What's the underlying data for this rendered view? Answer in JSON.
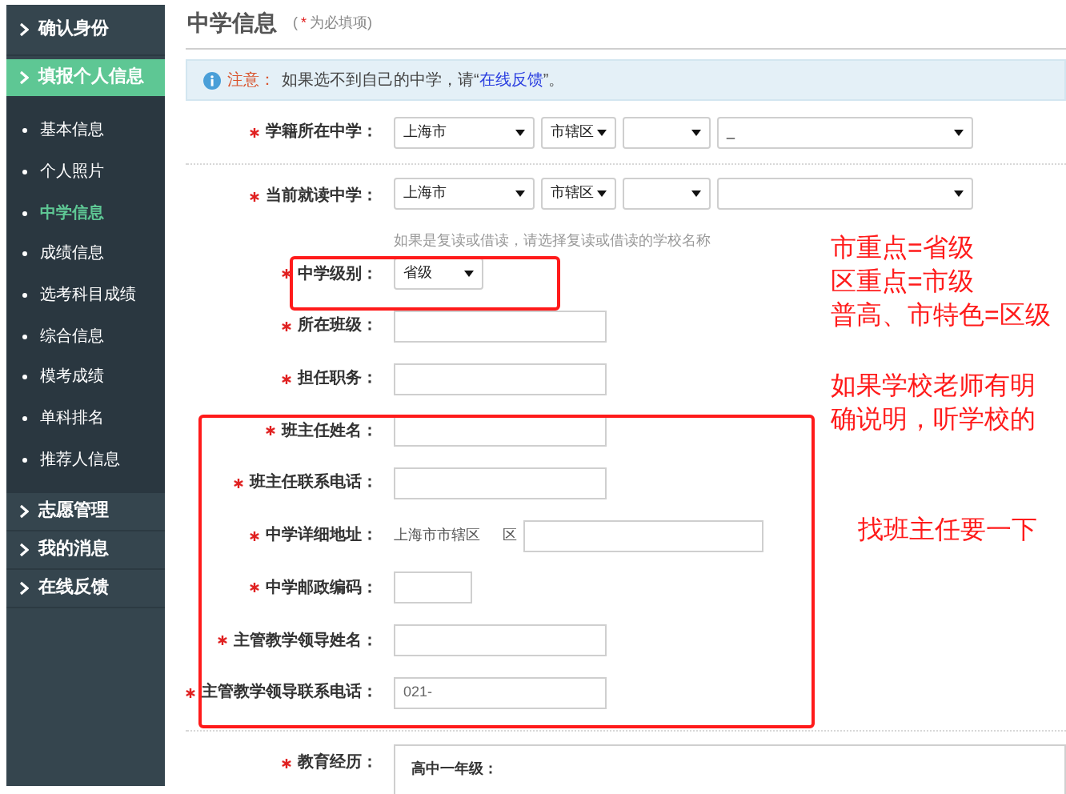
{
  "sidebar": {
    "items": [
      {
        "label": "确认身份",
        "selected": false
      },
      {
        "label": "填报个人信息",
        "selected": true,
        "children": [
          {
            "label": "基本信息",
            "selected": false
          },
          {
            "label": "个人照片",
            "selected": false
          },
          {
            "label": "中学信息",
            "selected": true
          },
          {
            "label": "成绩信息",
            "selected": false
          },
          {
            "label": "选考科目成绩",
            "selected": false
          },
          {
            "label": "综合信息",
            "selected": false
          },
          {
            "label": "模考成绩",
            "selected": false
          },
          {
            "label": "单科排名",
            "selected": false
          },
          {
            "label": "推荐人信息",
            "selected": false
          }
        ]
      },
      {
        "label": "志愿管理",
        "selected": false
      },
      {
        "label": "我的消息",
        "selected": false
      },
      {
        "label": "在线反馈",
        "selected": false
      }
    ]
  },
  "header": {
    "title": "中学信息",
    "note_open": "(",
    "note_star": "*",
    "note_text": "为必填项)"
  },
  "notice": {
    "label": "注意：",
    "text_before": "如果选不到自己的中学，请“",
    "link": "在线反馈",
    "text_after": "”。"
  },
  "form": {
    "rows": [
      {
        "kind": "selects",
        "label": "学籍所在中学：",
        "required": true,
        "selects": [
          {
            "kind": "dropdown",
            "value": "上海市"
          },
          {
            "kind": "dropdown",
            "value": "市辖区"
          },
          {
            "kind": "dropdown"
          },
          {
            "kind": "dropdown",
            "value": "_"
          }
        ]
      },
      {
        "kind": "selects",
        "label": "当前就读中学：",
        "required": true,
        "selects": [
          {
            "kind": "dropdown",
            "value": "上海市"
          },
          {
            "kind": "dropdown",
            "value": "市辖区"
          },
          {
            "kind": "dropdown"
          },
          {
            "kind": "dropdown"
          }
        ],
        "hint": "如果是复读或借读，请选择复读或借读的学校名称"
      },
      {
        "kind": "select",
        "label": "中学级别：",
        "required": true,
        "value": "省级"
      },
      {
        "kind": "input",
        "label": "所在班级：",
        "required": true
      },
      {
        "kind": "input",
        "label": "担任职务：",
        "required": true
      },
      {
        "kind": "input",
        "label": "班主任姓名：",
        "required": true
      },
      {
        "kind": "input",
        "label": "班主任联系电话：",
        "required": true
      },
      {
        "kind": "address",
        "label": "中学详细地址：",
        "required": true,
        "prefix": "上海市市辖区",
        "suffix": "区"
      },
      {
        "kind": "short-input",
        "label": "中学邮政编码：",
        "required": true
      },
      {
        "kind": "input",
        "label": "主管教学领导姓名：",
        "required": true
      },
      {
        "kind": "input",
        "label": "主管教学领导联系电话：",
        "required": true,
        "value": "021-"
      },
      {
        "kind": "textarea",
        "label": "教育经历：",
        "required": true,
        "value": "高中一年级："
      }
    ]
  },
  "annotations": {
    "notes": [
      {
        "lines": [
          "市重点=省级",
          "区重点=市级",
          "普高、市特色=区级"
        ]
      },
      {
        "lines": [
          "如果学校老师有明",
          "确说明，听学校的"
        ]
      },
      {
        "lines": [
          "找班主任要一下"
        ]
      }
    ]
  }
}
